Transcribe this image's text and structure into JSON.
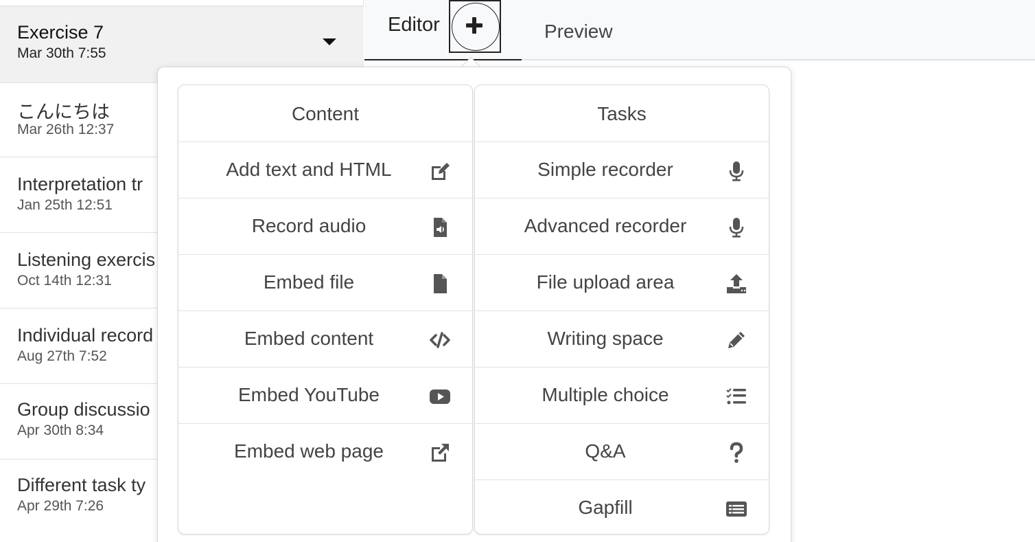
{
  "exercises": [
    {
      "title": "Exercise 7",
      "date": "Mar 30th 7:55"
    },
    {
      "title": "こんにちは",
      "date": "Mar 26th 12:37"
    },
    {
      "title": "Interpretation tr",
      "date": "Jan 25th 12:51"
    },
    {
      "title": "Listening exercis",
      "date": "Oct 14th 12:31"
    },
    {
      "title": "Individual record",
      "date": "Aug 27th 7:52"
    },
    {
      "title": "Group discussio",
      "date": "Apr 30th 8:34"
    },
    {
      "title": "Different task ty",
      "date": "Apr 29th 7:26"
    }
  ],
  "tabs": {
    "editor": "Editor",
    "preview": "Preview"
  },
  "add_button_icon": "plus-icon",
  "menu": {
    "content": {
      "header": "Content",
      "items": [
        {
          "label": "Add text and HTML",
          "icon": "edit-icon"
        },
        {
          "label": "Record audio",
          "icon": "audio-file-icon"
        },
        {
          "label": "Embed file",
          "icon": "file-icon"
        },
        {
          "label": "Embed content",
          "icon": "code-icon"
        },
        {
          "label": "Embed YouTube",
          "icon": "youtube-icon"
        },
        {
          "label": "Embed web page",
          "icon": "external-link-icon"
        }
      ]
    },
    "tasks": {
      "header": "Tasks",
      "items": [
        {
          "label": "Simple recorder",
          "icon": "microphone-icon"
        },
        {
          "label": "Advanced recorder",
          "icon": "microphone-icon"
        },
        {
          "label": "File upload area",
          "icon": "upload-icon"
        },
        {
          "label": "Writing space",
          "icon": "pencil-icon"
        },
        {
          "label": "Multiple choice",
          "icon": "checklist-icon"
        },
        {
          "label": "Q&A",
          "icon": "question-icon"
        },
        {
          "label": "Gapfill",
          "icon": "gapfill-icon"
        }
      ]
    }
  },
  "colors": {
    "text": "#444444",
    "border": "#dcdcdc",
    "selected_bg": "#f1f1f1",
    "tab_bg": "#f8f9fb"
  }
}
